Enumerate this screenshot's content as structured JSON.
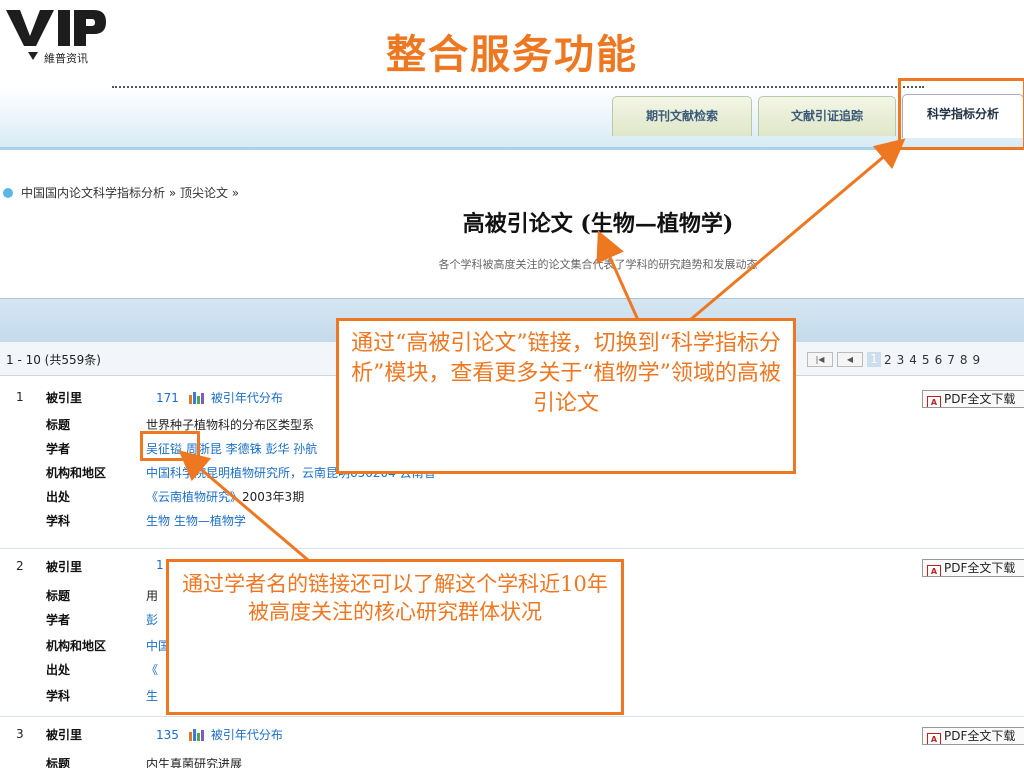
{
  "slide": {
    "logo_text": "維普资讯",
    "title": "整合服务功能"
  },
  "tabs": [
    {
      "label": "期刊文献检索",
      "active": false
    },
    {
      "label": "文献引证追踪",
      "active": false
    },
    {
      "label": "科学指标分析",
      "active": true
    }
  ],
  "breadcrumb": "中国国内论文科学指标分析 » 顶尖论文 »",
  "page": {
    "heading": "高被引论文 (生物—植物学)",
    "subheading": "各个学科被高度关注的论文集合代表了学科的研究趋势和发展动态"
  },
  "results": {
    "count_label": "1 - 10 (共559条)",
    "pager": {
      "current": "1",
      "pages": [
        "2",
        "3",
        "4",
        "5",
        "6",
        "7",
        "8",
        "9"
      ],
      "first_icon": "first-page-icon",
      "prev_icon": "prev-page-icon"
    }
  },
  "labels": {
    "cited": "被引里",
    "title": "标题",
    "scholar": "学者",
    "institution": "机构和地区",
    "source": "出处",
    "subject": "学科",
    "cite_years": "被引年代分布",
    "pdf": "PDF全文下载"
  },
  "records": [
    {
      "index": "1",
      "cited": "171",
      "title": "世界种子植物科的分布区类型系",
      "scholars": "吴征镒 周浙昆 李德铢 彭华 孙航",
      "institution": "中国科学院昆明植物研究所，云南昆明650204 云南省",
      "source_journal": "《云南植物研究》",
      "source_issue": "2003年3期",
      "subject": "生物 生物—植物学"
    },
    {
      "index": "2",
      "cited": "1",
      "title": "用",
      "scholars": "彭",
      "institution": "中国",
      "source_journal": "《",
      "source_issue": "",
      "subject": "生"
    },
    {
      "index": "3",
      "cited": "135",
      "title": "内生真菌研究进展",
      "scholars": "",
      "institution": "",
      "source_journal": "",
      "source_issue": "",
      "subject": ""
    }
  ],
  "callouts": {
    "callout1": "通过“高被引论文”链接，切换到“科学指标分析”模块，查看更多关于“植物学”领域的高被引论文",
    "callout2": "通过学者名的链接还可以了解这个学科近10年被高度关注的核心研究群体状况"
  },
  "colors": {
    "accent": "#ee7722",
    "link": "#1b6fc6",
    "header_bar": "#d5e6f2"
  }
}
